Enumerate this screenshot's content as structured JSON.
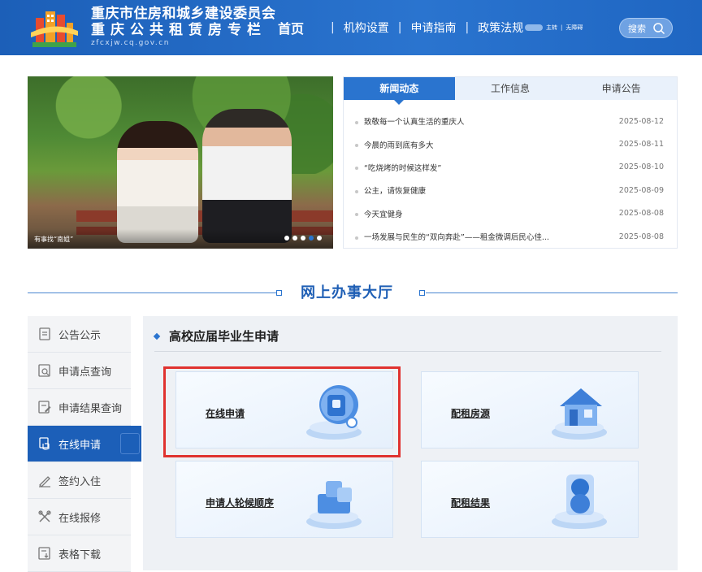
{
  "header": {
    "title_line1": "重庆市住房和城乡建设委员会",
    "title_line2": "重庆公共租赁房专栏",
    "domain": "zfcxjw.cq.gov.cn",
    "nav": [
      "首页",
      "机构设置",
      "申请指南",
      "政策法规"
    ],
    "nav_extra": [
      "主转",
      "无障碍"
    ],
    "search_label": "搜索"
  },
  "banner": {
    "caption": "有事找“南姐”",
    "slide_count": 5,
    "active_slide": 4
  },
  "news": {
    "tabs": [
      "新闻动态",
      "工作信息",
      "申请公告"
    ],
    "active_tab": 0,
    "items": [
      {
        "title": "致敬每一个认真生活的重庆人",
        "date": "2025-08-12"
      },
      {
        "title": "今晨的雨到底有多大",
        "date": "2025-08-11"
      },
      {
        "title": "“吃烧烤的时候这样发”",
        "date": "2025-08-10"
      },
      {
        "title": "公主，请恢复健康",
        "date": "2025-08-09"
      },
      {
        "title": "今天宜健身",
        "date": "2025-08-08"
      },
      {
        "title": "一场发展与民生的“双向奔赴”——租金微调后民心佳...",
        "date": "2025-08-08"
      }
    ]
  },
  "section": {
    "title": "网上办事大厅"
  },
  "sidebar": {
    "items": [
      {
        "label": "公告公示",
        "icon": "notice-icon"
      },
      {
        "label": "申请点查询",
        "icon": "search-doc-icon"
      },
      {
        "label": "申请结果查询",
        "icon": "result-doc-icon"
      },
      {
        "label": "在线申请",
        "icon": "hand-apply-icon"
      },
      {
        "label": "签约入住",
        "icon": "sign-pen-icon"
      },
      {
        "label": "在线报修",
        "icon": "repair-tools-icon"
      },
      {
        "label": "表格下载",
        "icon": "download-form-icon"
      }
    ],
    "active_index": 3
  },
  "main": {
    "title": "高校应届毕业生申请",
    "cards": [
      {
        "label": "在线申请",
        "icon": "lock-shield-icon"
      },
      {
        "label": "配租房源",
        "icon": "house-icon"
      },
      {
        "label": "申请人轮候顺序",
        "icon": "cube-stack-icon"
      },
      {
        "label": "配租结果",
        "icon": "sphere-icon"
      }
    ]
  },
  "colors": {
    "brand_blue": "#2a74cf",
    "header_blue": "#1c5fb8",
    "highlight_red": "#e0322f"
  }
}
